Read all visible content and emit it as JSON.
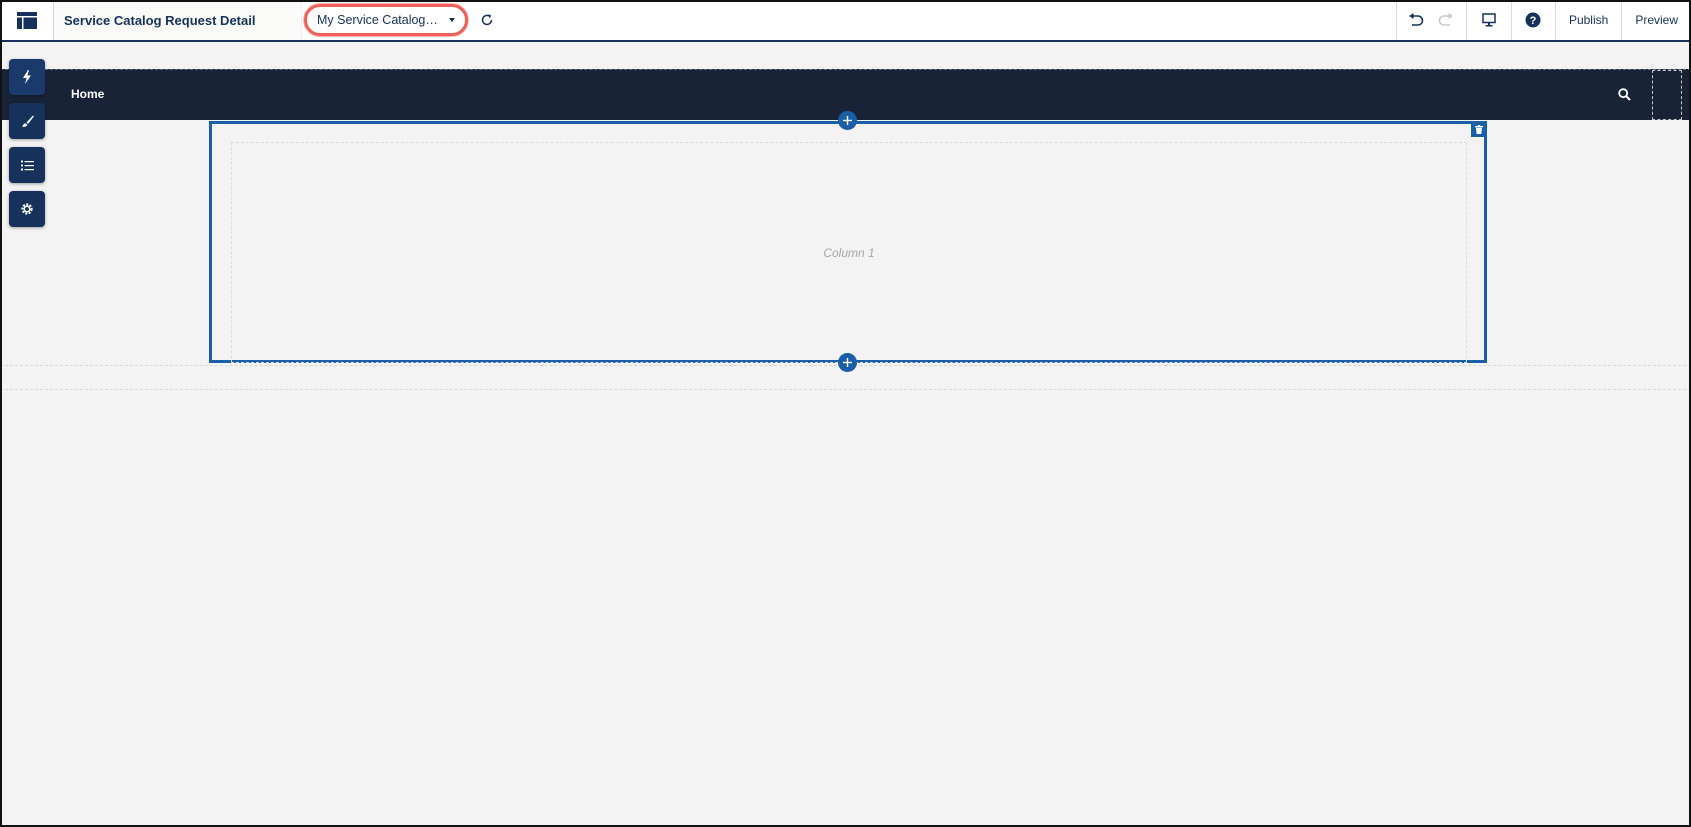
{
  "toolbar": {
    "page_title": "Service Catalog Request Detail",
    "variation_label": "My Service Catalog Re...",
    "publish_label": "Publish",
    "preview_label": "Preview"
  },
  "rail": {
    "items": [
      "components-icon",
      "theme-brush-icon",
      "page-structure-icon",
      "settings-gear-icon"
    ]
  },
  "canvas": {
    "nav_home_label": "Home",
    "column_label": "Column 1"
  },
  "colors": {
    "brand_navy": "#16325c",
    "nav_bar": "#192338",
    "selection_blue": "#1b5fa8",
    "highlight_red": "#f0605a"
  }
}
